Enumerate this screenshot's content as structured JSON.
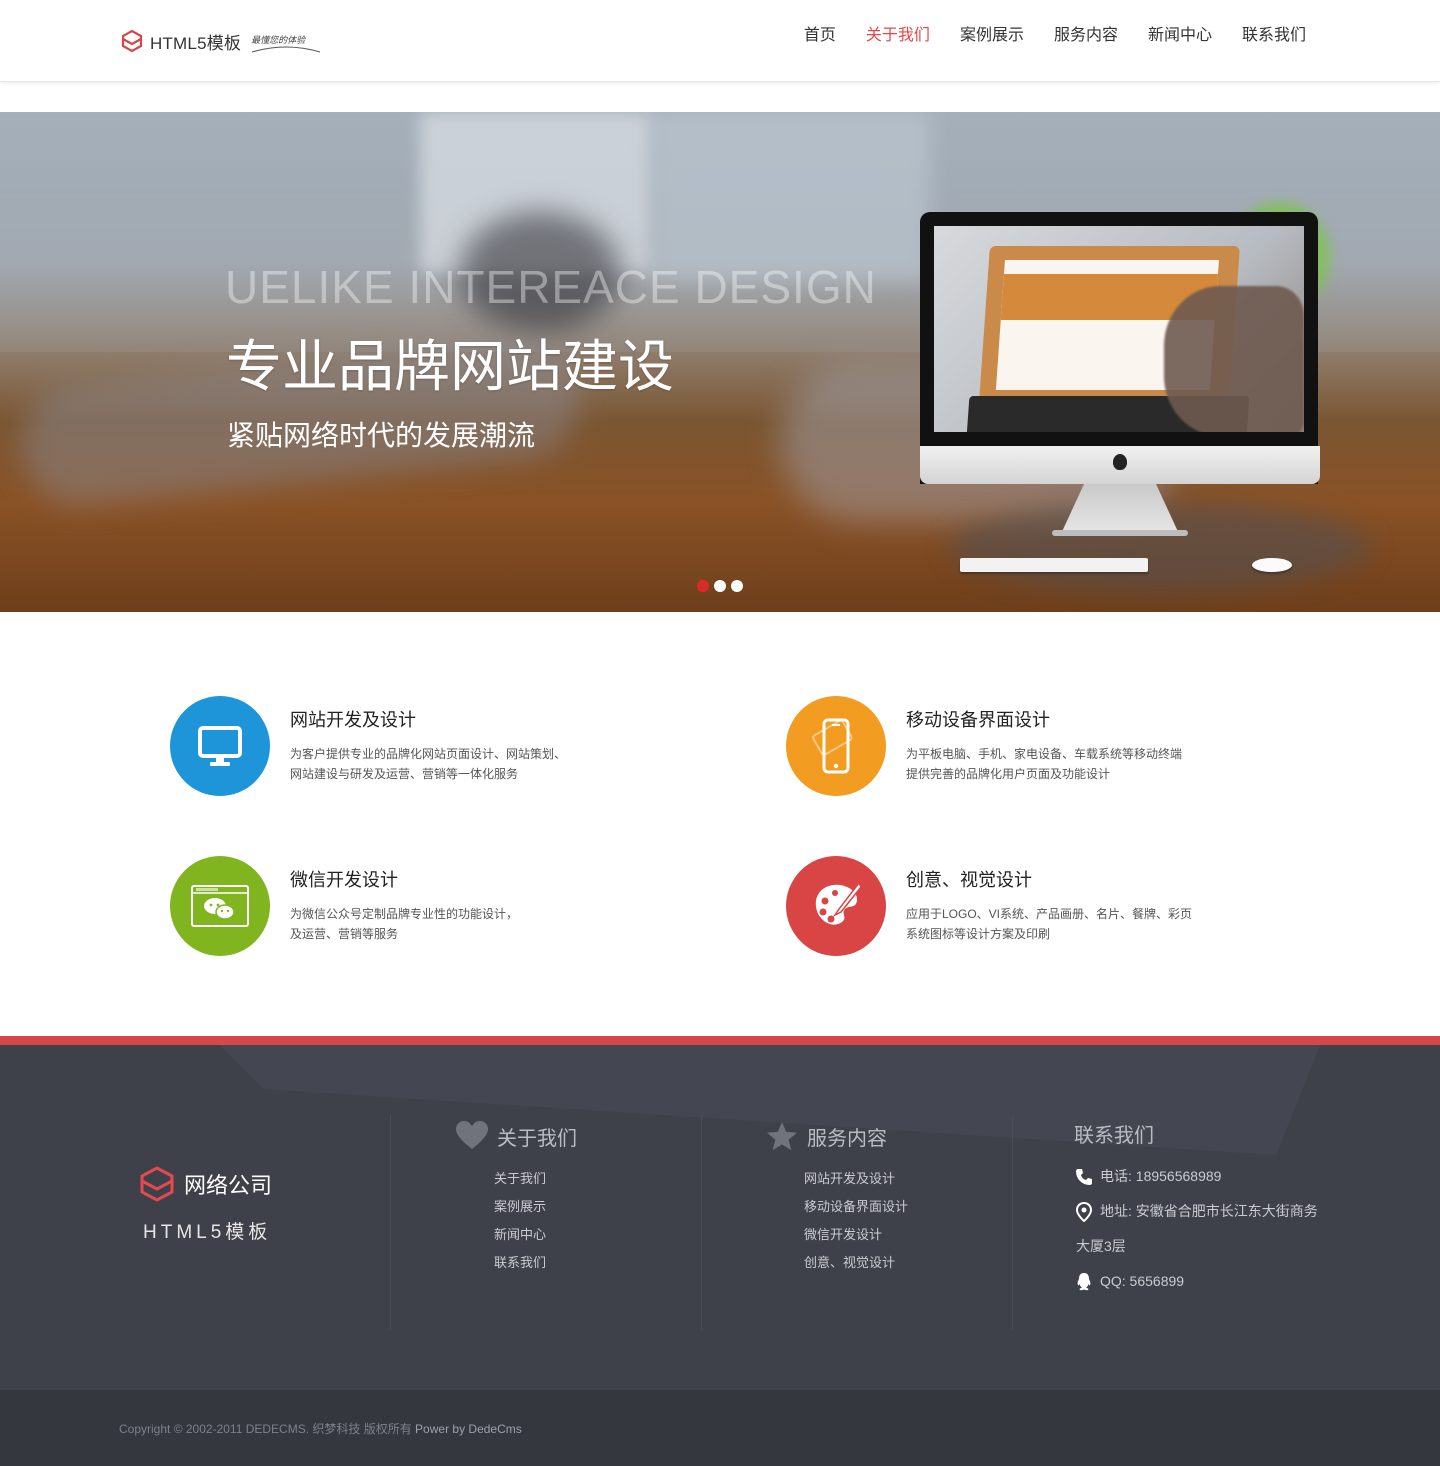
{
  "header": {
    "logo_text": "HTML5模板",
    "logo_slogan": "最懂您的体验",
    "nav": [
      {
        "label": "首页",
        "active": false
      },
      {
        "label": "关于我们",
        "active": true
      },
      {
        "label": "案例展示",
        "active": false
      },
      {
        "label": "服务内容",
        "active": false
      },
      {
        "label": "新闻中心",
        "active": false
      },
      {
        "label": "联系我们",
        "active": false
      }
    ]
  },
  "banner": {
    "title_en": "UELIKE INTEREACE DESIGN",
    "title_cn": "专业品牌网站建设",
    "subtitle": "紧贴网络时代的发展潮流",
    "slides": 3,
    "active_slide": 1
  },
  "services": [
    {
      "title": "网站开发及设计",
      "desc": [
        "为客户提供专业的品牌化网站页面设计、网站策划、",
        "网站建设与研发及运营、营销等一体化服务"
      ],
      "color": "#1e95d8",
      "icon": "monitor-icon"
    },
    {
      "title": "移动设备界面设计",
      "desc": [
        "为平板电脑、手机、家电设备、车载系统等移动终端",
        "提供完善的品牌化用户页面及功能设计"
      ],
      "color": "#f29c22",
      "icon": "mobile-phone-icon"
    },
    {
      "title": "微信开发设计",
      "desc": [
        "为微信公众号定制品牌专业性的功能设计，",
        "及运营、营销等服务"
      ],
      "color": "#80b520",
      "icon": "wechat-icon"
    },
    {
      "title": "创意、视觉设计",
      "desc": [
        "应用于LOGO、VI系统、产品画册、名片、餐牌、彩页",
        "系统图标等设计方案及印刷"
      ],
      "color": "#d94444",
      "icon": "palette-icon"
    }
  ],
  "footer": {
    "company_name": "网络公司",
    "company_sub": "HTML5模板",
    "about": {
      "title": "关于我们",
      "links": [
        "关于我们",
        "案例展示",
        "新闻中心",
        "联系我们"
      ]
    },
    "service": {
      "title": "服务内容",
      "links": [
        "网站开发及设计",
        "移动设备界面设计",
        "微信开发设计",
        "创意、视觉设计"
      ]
    },
    "contact": {
      "title": "联系我们",
      "phone": "电话: 18956568989",
      "address": "地址: 安徽省合肥市长江东大街商务",
      "address2": "大厦3层",
      "qq": "QQ: 5656899"
    },
    "copyright": "Copyright © 2002-2011 DEDECMS. 织梦科技 版权所有 ",
    "powered": "Power by DedeCms"
  },
  "colors": {
    "accent": "#e54848",
    "footer_bg": "#3e4149",
    "footer_border": "#d7464a",
    "copyright_bg": "#34373e"
  }
}
